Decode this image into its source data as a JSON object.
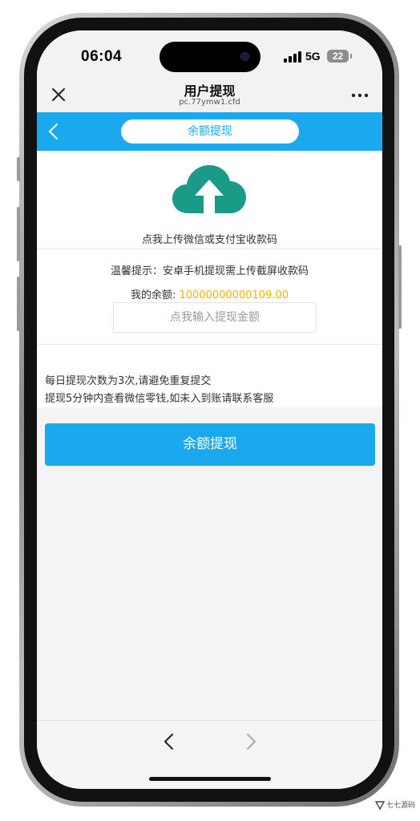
{
  "status_bar": {
    "time": "06:04",
    "network": "5G",
    "battery": "22"
  },
  "browser": {
    "title": "用户提现",
    "url": "pc.77ymw1.cfd",
    "close_icon": "close-icon",
    "more_icon": "more-icon"
  },
  "nav": {
    "back_icon": "chevron-left-icon",
    "title": "余额提现"
  },
  "upload": {
    "icon": "cloud-upload-icon",
    "label": "点我上传微信或支付宝收款码",
    "icon_color": "#1a9a87"
  },
  "info": {
    "tip": "温馨提示：安卓手机提现需上传截屏收款码",
    "balance_label": "我的余额: ",
    "balance_value": "10000000000109.00",
    "balance_color": "#f5b300",
    "amount_placeholder": "点我输入提现金额",
    "amount_value": ""
  },
  "notes": {
    "line1": "每日提现次数为3次,请避免重复提交",
    "line2": "提现5分钟内查看微信零钱,如未入到账请联系客服"
  },
  "actions": {
    "withdraw_label": "余额提现"
  },
  "bottom_bar": {
    "back_icon": "chevron-left-icon",
    "forward_icon": "chevron-right-icon"
  },
  "watermark": {
    "text": "七七源码"
  },
  "colors": {
    "accent": "#1aa9ee",
    "page_bg": "#f4f4f6"
  }
}
